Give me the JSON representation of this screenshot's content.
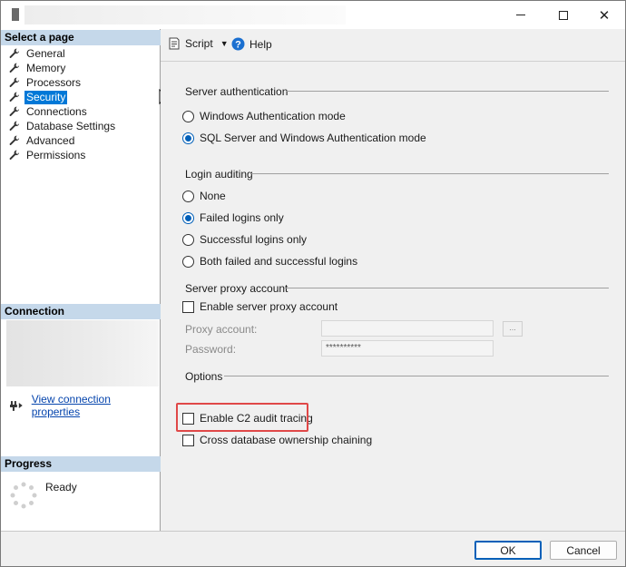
{
  "left_pane": {
    "select_page_header": "Select a page",
    "pages": [
      "General",
      "Memory",
      "Processors",
      "Security",
      "Connections",
      "Database Settings",
      "Advanced",
      "Permissions"
    ],
    "selected_page": "Security",
    "connection_header": "Connection",
    "view_connection_properties": "View connection properties",
    "progress_header": "Progress",
    "progress_status": "Ready"
  },
  "toolbar": {
    "script_label": "Script",
    "help_label": "Help"
  },
  "server_authentication": {
    "label": "Server authentication",
    "options": [
      "Windows Authentication mode",
      "SQL Server and Windows Authentication mode"
    ],
    "selected": "SQL Server and Windows Authentication mode"
  },
  "login_auditing": {
    "label": "Login auditing",
    "options": [
      "None",
      "Failed logins only",
      "Successful logins only",
      "Both failed and successful logins"
    ],
    "selected": "Failed logins only"
  },
  "server_proxy": {
    "label": "Server proxy account",
    "enable_label": "Enable server proxy account",
    "enabled": false,
    "proxy_account_label": "Proxy account:",
    "proxy_account_value": "",
    "browse_label": "...",
    "password_label": "Password:",
    "password_value": "**********"
  },
  "options": {
    "label": "Options",
    "c2_audit_label": "Enable C2 audit tracing",
    "c2_audit_checked": false,
    "cross_db_label": "Cross database ownership chaining",
    "cross_db_checked": false
  },
  "footer": {
    "ok_label": "OK",
    "cancel_label": "Cancel"
  },
  "colors": {
    "accent": "#0078d7",
    "header_bg": "#c5d8ea",
    "highlight": "#e04848"
  }
}
